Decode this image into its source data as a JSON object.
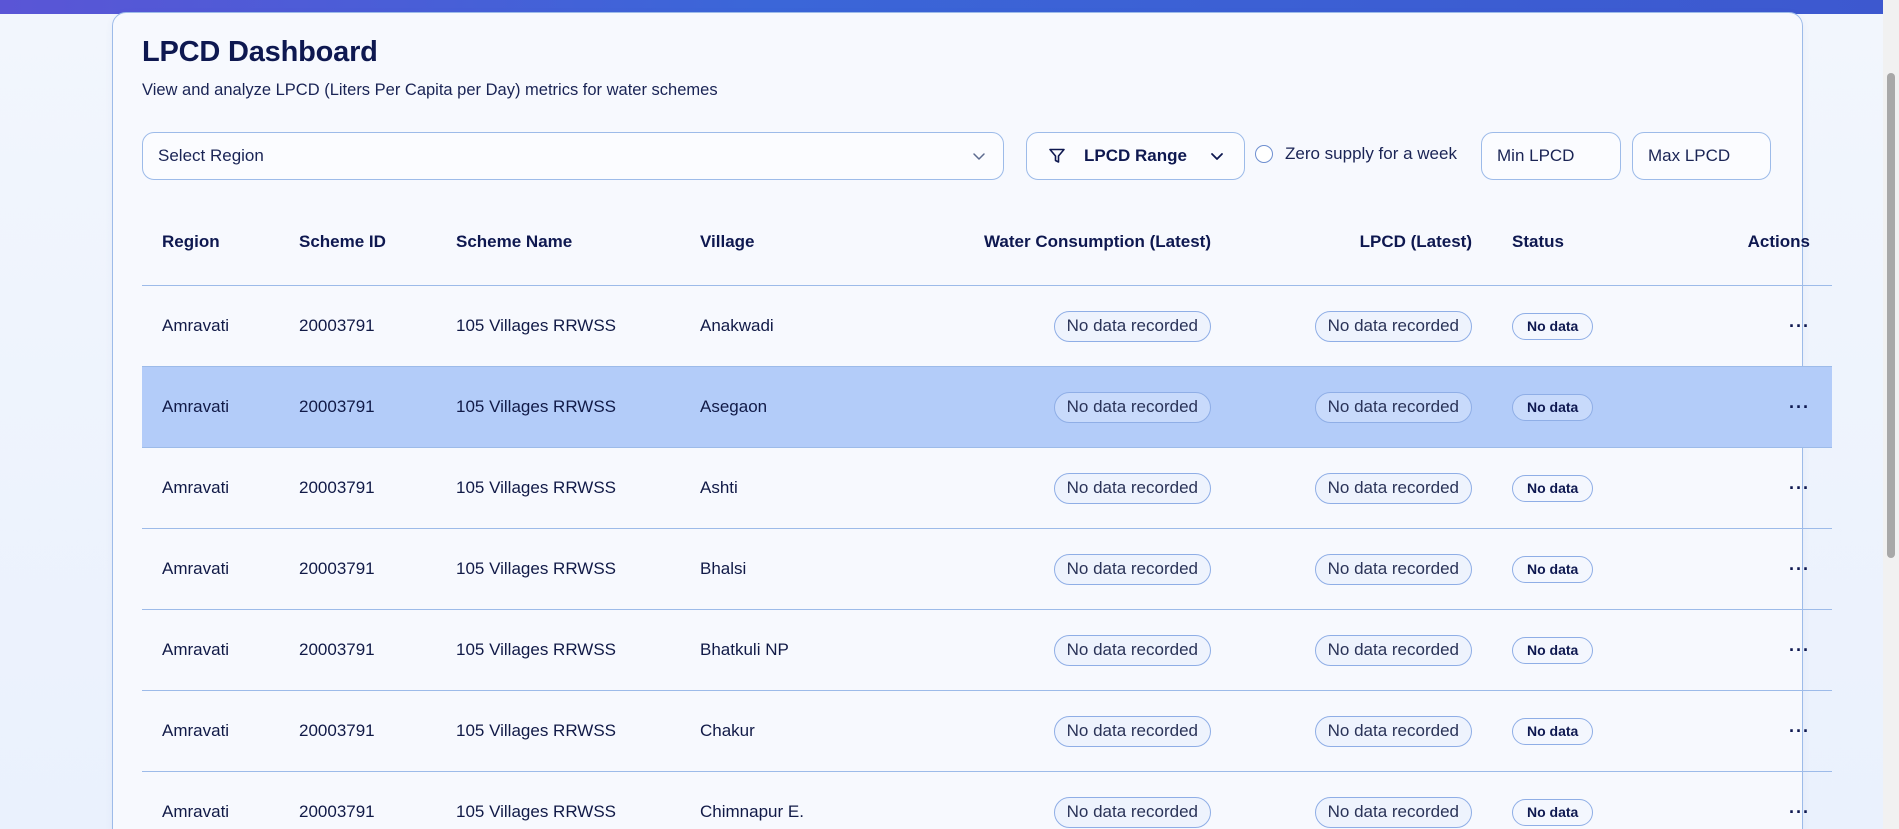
{
  "header": {
    "title": "LPCD Dashboard",
    "subtitle": "View and analyze LPCD (Liters Per Capita per Day) metrics for water schemes"
  },
  "filters": {
    "region_placeholder": "Select Region",
    "range_label": "LPCD Range",
    "zero_supply_label": "Zero supply for a week",
    "min_placeholder": "Min LPCD",
    "max_placeholder": "Max LPCD"
  },
  "table": {
    "columns": {
      "region": "Region",
      "scheme_id": "Scheme ID",
      "scheme_name": "Scheme Name",
      "village": "Village",
      "water": "Water Consumption (Latest)",
      "lpcd": "LPCD (Latest)",
      "status": "Status",
      "actions": "Actions"
    },
    "rows": [
      {
        "region": "Amravati",
        "scheme_id": "20003791",
        "scheme_name": "105 Villages RRWSS",
        "village": "Anakwadi",
        "water": "No data recorded",
        "lpcd": "No data recorded",
        "status": "No data",
        "actions": "···"
      },
      {
        "region": "Amravati",
        "scheme_id": "20003791",
        "scheme_name": "105 Villages RRWSS",
        "village": "Asegaon",
        "water": "No data recorded",
        "lpcd": "No data recorded",
        "status": "No data",
        "actions": "···"
      },
      {
        "region": "Amravati",
        "scheme_id": "20003791",
        "scheme_name": "105 Villages RRWSS",
        "village": "Ashti",
        "water": "No data recorded",
        "lpcd": "No data recorded",
        "status": "No data",
        "actions": "···"
      },
      {
        "region": "Amravati",
        "scheme_id": "20003791",
        "scheme_name": "105 Villages RRWSS",
        "village": "Bhalsi",
        "water": "No data recorded",
        "lpcd": "No data recorded",
        "status": "No data",
        "actions": "···"
      },
      {
        "region": "Amravati",
        "scheme_id": "20003791",
        "scheme_name": "105 Villages RRWSS",
        "village": "Bhatkuli NP",
        "water": "No data recorded",
        "lpcd": "No data recorded",
        "status": "No data",
        "actions": "···"
      },
      {
        "region": "Amravati",
        "scheme_id": "20003791",
        "scheme_name": "105 Villages RRWSS",
        "village": "Chakur",
        "water": "No data recorded",
        "lpcd": "No data recorded",
        "status": "No data",
        "actions": "···"
      },
      {
        "region": "Amravati",
        "scheme_id": "20003791",
        "scheme_name": "105 Villages RRWSS",
        "village": "Chimnapur E.",
        "water": "No data recorded",
        "lpcd": "No data recorded",
        "status": "No data",
        "actions": "···"
      }
    ]
  },
  "icons": {
    "select_chevron": "chevron-down-icon",
    "range_filter": "filter-icon",
    "range_chevron": "chevron-down-icon",
    "row_actions": "more-horizontal-icon"
  },
  "colors": {
    "accent_bar": "#3b66d8",
    "border": "#9dbbe9",
    "selected_row": "#b3ccf9",
    "text_dark": "#0e1850"
  }
}
